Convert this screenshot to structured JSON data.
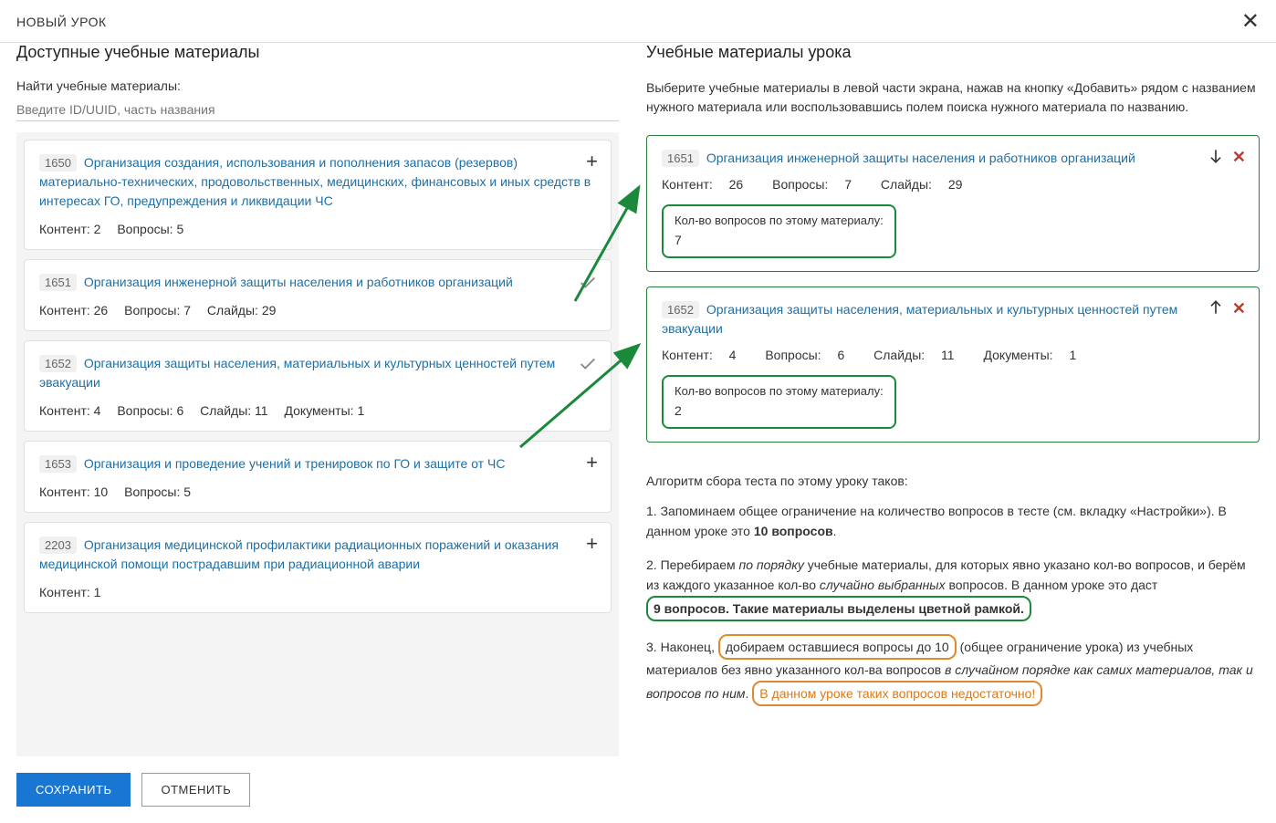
{
  "header": {
    "title": "НОВЫЙ УРОК"
  },
  "left": {
    "title": "Доступные учебные материалы",
    "search_label": "Найти учебные материалы:",
    "search_placeholder": "Введите ID/UUID, часть названия",
    "items": [
      {
        "id": "1650",
        "title": "Организация создания, использования и пополнения запасов (резервов) материально-технических, продовольственных, медицинских, финансовых и иных средств в интересах ГО, предупреждения и ликвидации ЧС",
        "content": "2",
        "questions": "5",
        "slides": "",
        "documents": "",
        "added": false
      },
      {
        "id": "1651",
        "title": "Организация инженерной защиты населения и работников организаций",
        "content": "26",
        "questions": "7",
        "slides": "29",
        "documents": "",
        "added": true
      },
      {
        "id": "1652",
        "title": "Организация защиты населения, материальных и культурных ценностей путем эвакуации",
        "content": "4",
        "questions": "6",
        "slides": "11",
        "documents": "1",
        "added": true
      },
      {
        "id": "1653",
        "title": "Организация и проведение учений и тренировок по ГО и защите от ЧС",
        "content": "10",
        "questions": "5",
        "slides": "",
        "documents": "",
        "added": false
      },
      {
        "id": "2203",
        "title": "Организация медицинской профилактики радиационных поражений и оказания медицинской помощи пострадавшим при радиационной аварии",
        "content": "1",
        "questions": "",
        "slides": "",
        "documents": "",
        "added": false
      }
    ],
    "meta_labels": {
      "content": "Контент:",
      "questions": "Вопросы:",
      "slides": "Слайды:",
      "documents": "Документы:"
    }
  },
  "right": {
    "title": "Учебные материалы урока",
    "instructions": "Выберите учебные материалы в левой части экрана, нажав на кнопку «Добавить» рядом с названием нужного материала или воспользовавшись полем поиска нужного материала по названию.",
    "selected": [
      {
        "id": "1651",
        "title": "Организация инженерной защиты населения и работников организаций",
        "content": "26",
        "questions": "7",
        "slides": "29",
        "documents": "",
        "q_count": "7",
        "dir": "down"
      },
      {
        "id": "1652",
        "title": "Организация защиты населения, материальных и культурных ценностей путем эвакуации",
        "content": "4",
        "questions": "6",
        "slides": "11",
        "documents": "1",
        "q_count": "2",
        "dir": "up"
      }
    ],
    "question_box_label": "Кол-во вопросов по этому материалу:",
    "algo_title": "Алгоритм сбора теста по этому уроку таков:",
    "step1_a": "1. Запоминаем общее ограничение на количество вопросов в тесте (см. вкладку «Настройки»). В данном уроке это ",
    "step1_b": "10 вопросов",
    "step1_c": ".",
    "step2_a": "2. Перебираем ",
    "step2_b": "по порядку",
    "step2_c": " учебные материалы, для которых явно указано кол-во вопросов, и берём из каждого указанное кол-во ",
    "step2_d": "случайно выбранных",
    "step2_e": " вопросов. В данном уроке это даст",
    "step2_highlight": "9 вопросов. Такие материалы выделены цветной рамкой.",
    "step3_a": "3. Наконец, ",
    "step3_highlight1": "добираем оставшиеся вопросы до 10",
    "step3_b": " (общее ограничение урока) из учебных материалов без явно указанного кол-ва вопросов ",
    "step3_c": "в случайном порядке как самих материалов, так и вопросов по ним",
    "step3_d": ". ",
    "step3_highlight2": "В данном уроке таких вопросов недостаточно!"
  },
  "footer": {
    "save": "СОХРАНИТЬ",
    "cancel": "ОТМЕНИТЬ"
  }
}
